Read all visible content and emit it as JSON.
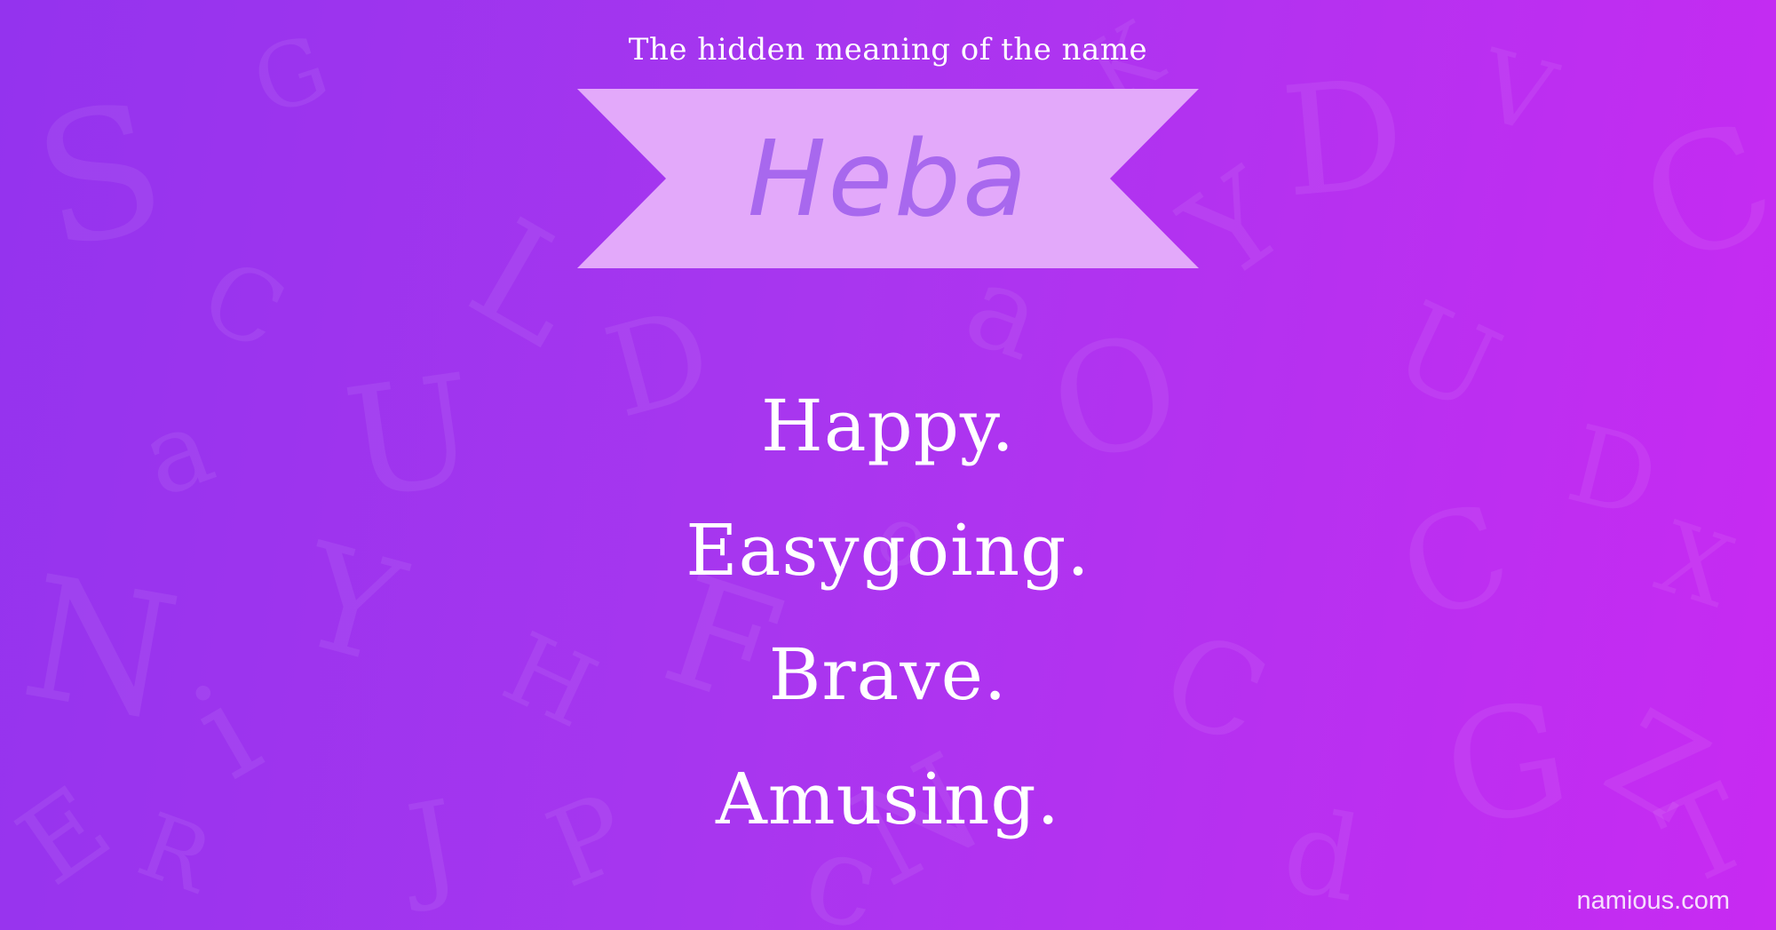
{
  "header": {
    "subtitle": "The hidden meaning of the name"
  },
  "banner": {
    "name": "Heba"
  },
  "traits": [
    "Happy.",
    "Easygoing.",
    "Brave.",
    "Amusing."
  ],
  "footer": {
    "site": "namious.com"
  },
  "colors": {
    "background_left": "#9433ee",
    "background_right": "#c82af2",
    "banner_fill": "#e3a9fa",
    "banner_text": "#a868ee",
    "text": "#ffffff"
  }
}
